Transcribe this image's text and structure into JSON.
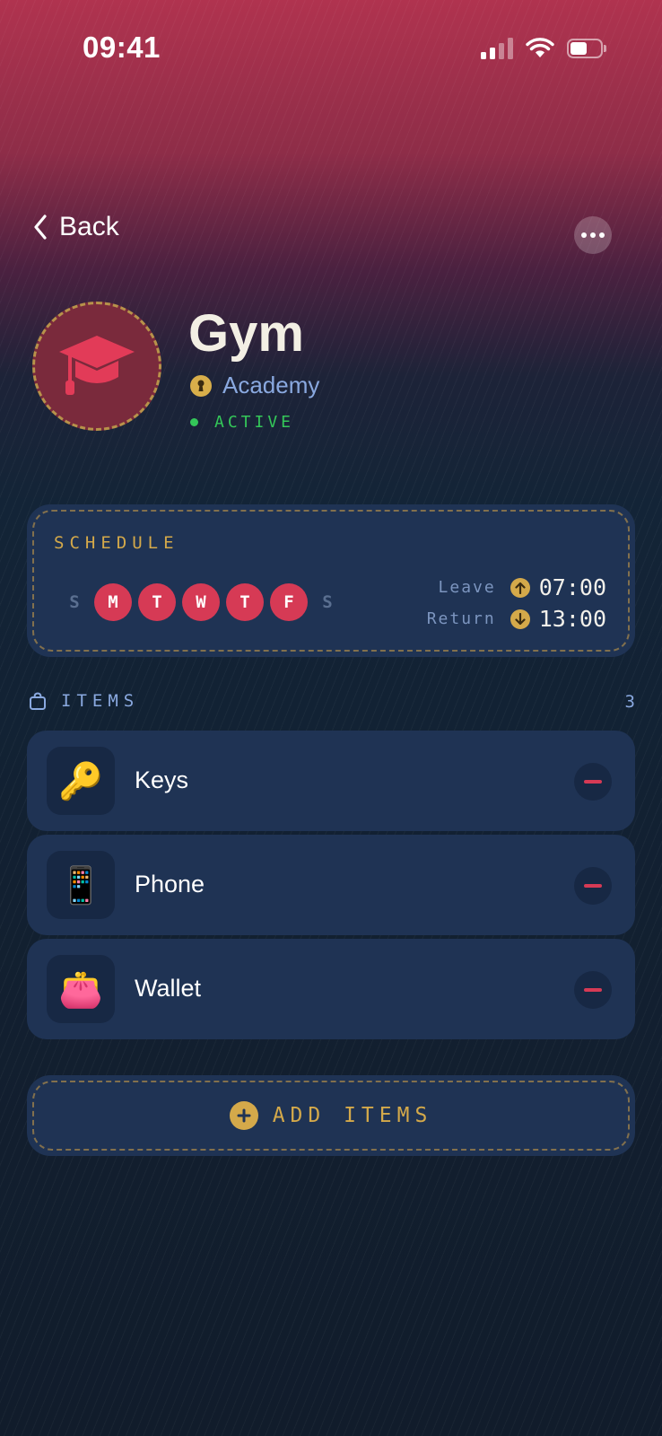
{
  "status_bar": {
    "time": "09:41",
    "battery_level": 0.55
  },
  "nav": {
    "back_label": "Back"
  },
  "header": {
    "title": "Gym",
    "category": "Academy",
    "status": "ACTIVE",
    "avatar_icon": "graduation-cap-icon",
    "category_icon": "keyhole-icon"
  },
  "schedule": {
    "label": "SCHEDULE",
    "days": [
      {
        "letter": "S",
        "active": false
      },
      {
        "letter": "M",
        "active": true
      },
      {
        "letter": "T",
        "active": true
      },
      {
        "letter": "W",
        "active": true
      },
      {
        "letter": "T",
        "active": true
      },
      {
        "letter": "F",
        "active": true
      },
      {
        "letter": "S",
        "active": false
      }
    ],
    "leave_label": "Leave",
    "leave_time": "07:00",
    "return_label": "Return",
    "return_time": "13:00"
  },
  "items": {
    "label": "ITEMS",
    "count": "3",
    "list": [
      {
        "label": "Keys",
        "emoji": "🔑",
        "icon": "key-icon"
      },
      {
        "label": "Phone",
        "emoji": "📱",
        "icon": "phone-icon"
      },
      {
        "label": "Wallet",
        "emoji": "👛",
        "icon": "purse-icon"
      }
    ]
  },
  "add_button": {
    "label": "ADD ITEMS"
  },
  "colors": {
    "accent_red": "#d63a55",
    "accent_gold": "#d4a94a",
    "active_green": "#34c759",
    "card_bg": "#1f3354"
  }
}
